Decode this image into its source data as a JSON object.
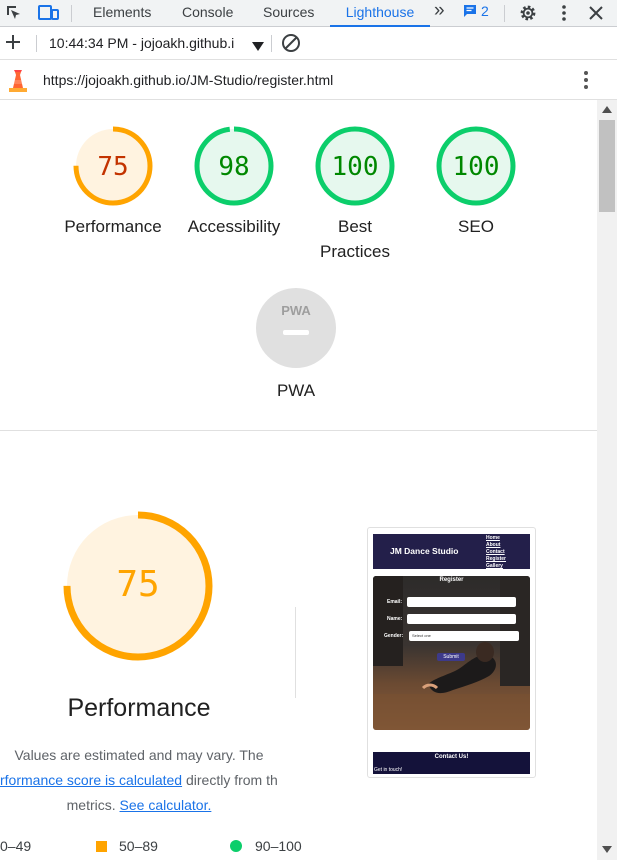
{
  "devtools": {
    "tabs": [
      "Elements",
      "Console",
      "Sources",
      "Lighthouse"
    ],
    "active_tab": "Lighthouse",
    "more_tabs_glyph": "»",
    "issues_count": "2",
    "report_label": "10:44:34 PM - jojoakh.github.i",
    "url": "https://jojoakh.github.io/JM-Studio/register.html"
  },
  "scores": [
    {
      "label": "Performance",
      "value": "75",
      "score": 0.75,
      "status": "average"
    },
    {
      "label": "Accessibility",
      "value": "98",
      "score": 0.98,
      "status": "pass"
    },
    {
      "label": "Best Practices",
      "value": "100",
      "score": 1.0,
      "status": "pass"
    },
    {
      "label": "SEO",
      "value": "100",
      "score": 1.0,
      "status": "pass"
    }
  ],
  "pwa": {
    "badge": "PWA",
    "label": "PWA"
  },
  "perf_section": {
    "value": "75",
    "score": 0.75,
    "title": "Performance",
    "desc_line1": "Values are estimated and may vary. The",
    "desc_link1": "rformance score is calculated",
    "desc_mid": " directly from these",
    "desc_line3a": "metrics. ",
    "desc_link2": "See calculator."
  },
  "legend": [
    {
      "range": "0–49",
      "color": "#ff4e42"
    },
    {
      "range": "50–89",
      "color": "#ffa400"
    },
    {
      "range": "90–100",
      "color": "#0cce6b"
    }
  ],
  "thumbnail": {
    "site_title": "JM Dance Studio",
    "nav": [
      "Home",
      "About",
      "Contact",
      "Register",
      "Gallery"
    ],
    "form_title": "Register",
    "email_label": "Email:",
    "name_label": "Name:",
    "gender_label": "Gender:",
    "gender_select": "Select one",
    "submit": "Submit",
    "footer_title": "Contact Us!",
    "footer_text": "Get in touch!"
  },
  "colors": {
    "average": "#ffa400",
    "average_text": "#c33300",
    "average_fill": "#fff3e0",
    "pass": "#0cce6b",
    "pass_text": "#008800",
    "pass_fill": "#e6f8ee",
    "accent": "#1a73e8"
  }
}
